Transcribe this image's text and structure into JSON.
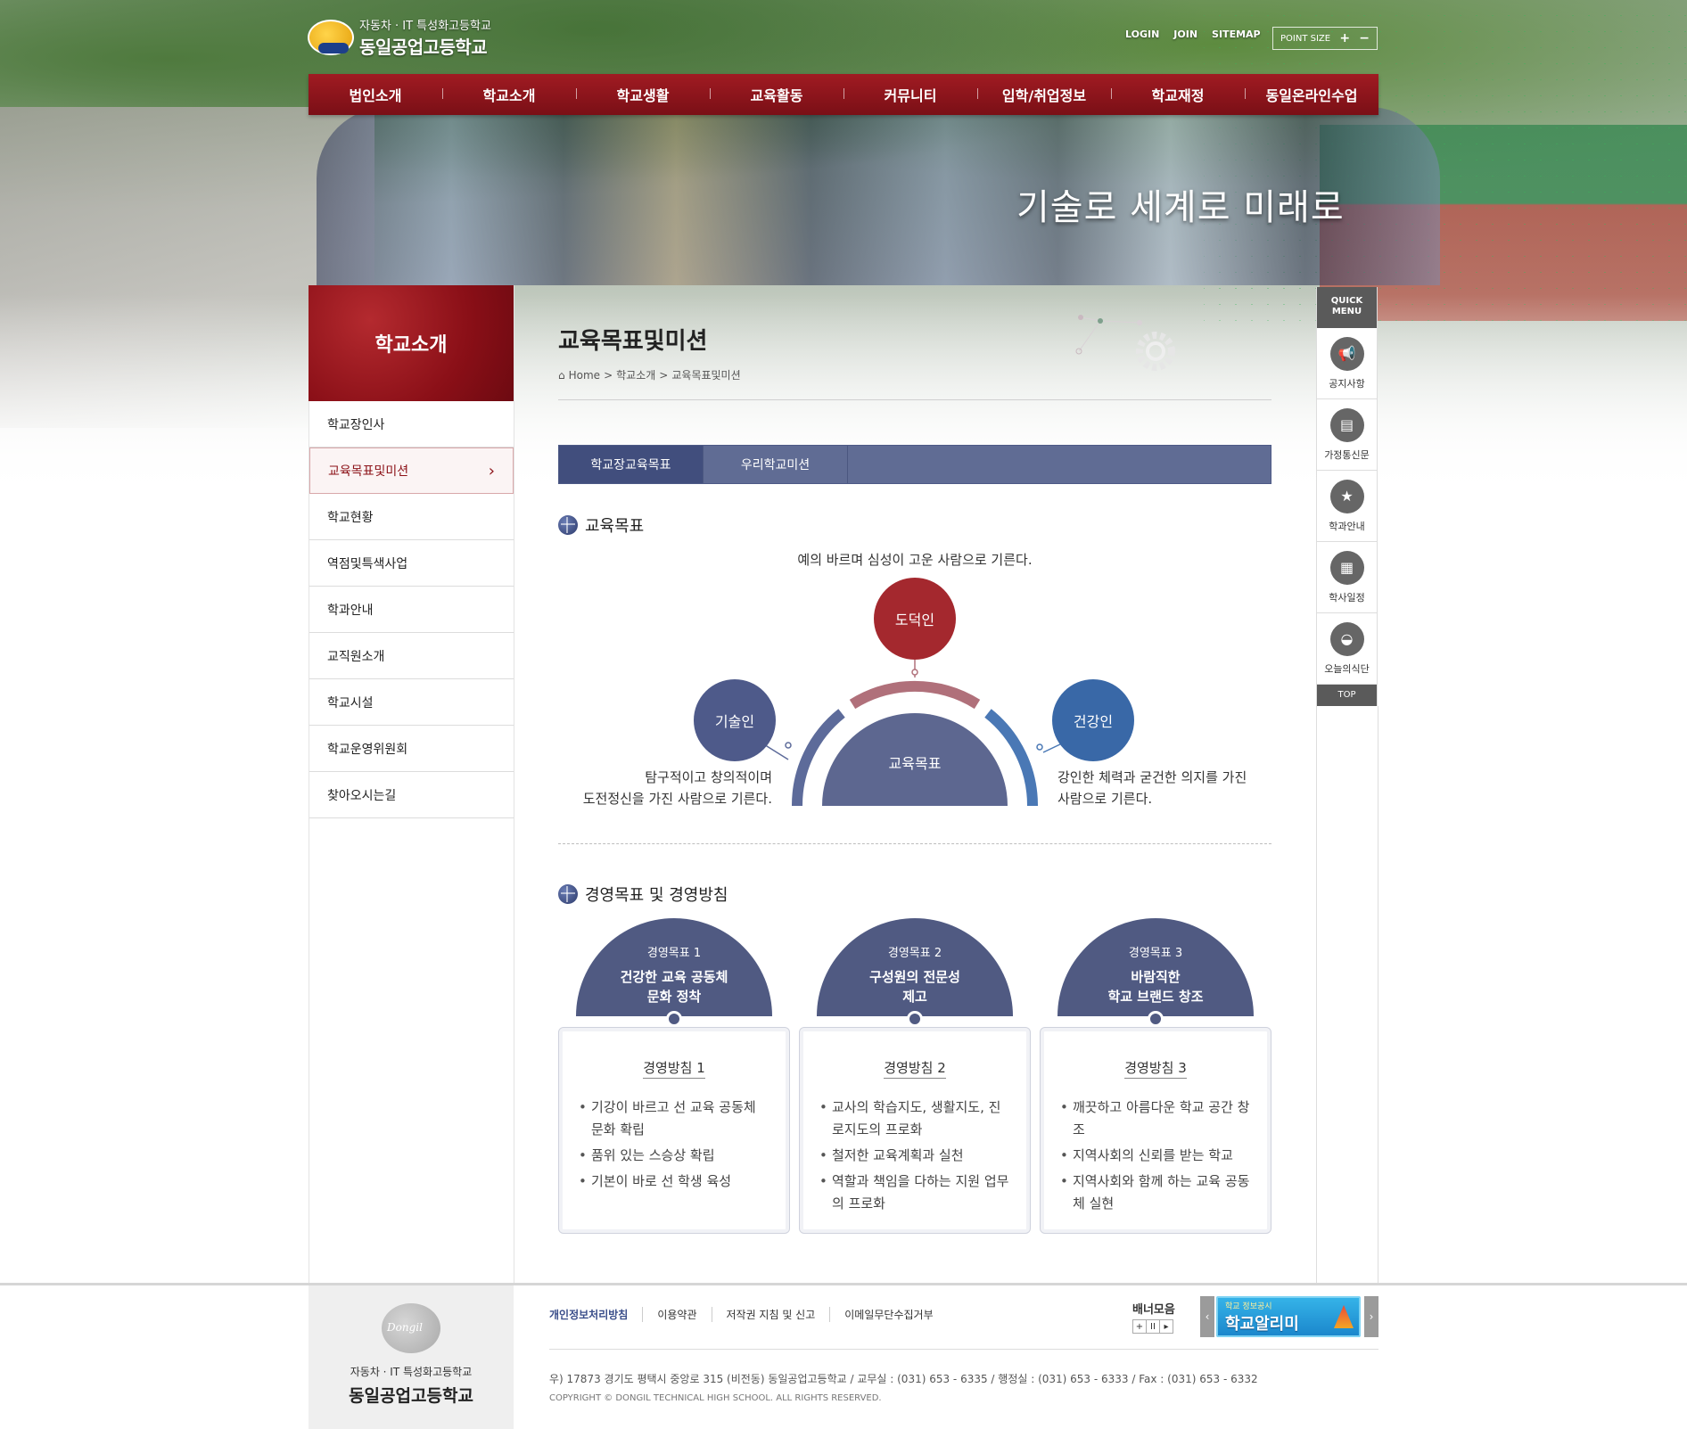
{
  "header": {
    "logo_sub": "자동차 · IT 특성화고등학교",
    "logo_name": "동일공업고등학교",
    "links": [
      "LOGIN",
      "JOIN",
      "SITEMAP"
    ],
    "point_size_label": "POINT SIZE",
    "point_plus": "+",
    "point_minus": "−",
    "slogan": "기술로 세계로 미래로"
  },
  "gnb": [
    "법인소개",
    "학교소개",
    "학교생활",
    "교육활동",
    "커뮤니티",
    "입학/취업정보",
    "학교재정",
    "동일온라인수업"
  ],
  "sidebar": {
    "title": "학교소개",
    "items": [
      "학교장인사",
      "교육목표및미션",
      "학교현황",
      "역점및특색사업",
      "학과안내",
      "교직원소개",
      "학교시설",
      "학교운영위원회",
      "찾아오시는길"
    ],
    "active_index": 1,
    "chevron": "›"
  },
  "page": {
    "title": "교육목표및미션",
    "breadcrumb": [
      "Home",
      "학교소개",
      "교육목표및미션"
    ],
    "breadcrumb_sep": ">",
    "home_icon": "⌂"
  },
  "tabs": [
    "학교장교육목표",
    "우리학교미션"
  ],
  "education": {
    "heading": "교육목표",
    "lead": "예의 바르며 심성이 고운 사람으로 기른다.",
    "center": "교육목표",
    "top": "도덕인",
    "left": "기술인",
    "right": "건강인",
    "left_desc": [
      "탐구적이고 창의적이며",
      "도전정신을 가진 사람으로 기른다."
    ],
    "right_desc": [
      "강인한 체력과 굳건한 의지를 가진",
      "사람으로 기른다."
    ],
    "colors": {
      "top": "#a4282e",
      "left": "#4e5a8a",
      "right": "#3968a7",
      "center": "#5d6790"
    }
  },
  "management": {
    "heading": "경영목표 및 경영방침",
    "goals": [
      {
        "label": "경영목표 1",
        "title": [
          "건강한 교육 공동체",
          "문화 정착"
        ],
        "policy": "경영방침 1",
        "items": [
          "기강이 바르고 선 교육 공동체 문화 확립",
          "품위 있는 스승상 확립",
          "기본이 바로 선 학생 육성"
        ]
      },
      {
        "label": "경영목표 2",
        "title": [
          "구성원의 전문성",
          "제고"
        ],
        "policy": "경영방침 2",
        "items": [
          "교사의 학습지도, 생활지도, 진로지도의 프로화",
          "철저한 교육계획과 실천",
          "역할과 책임을 다하는 지원 업무의 프로화"
        ]
      },
      {
        "label": "경영목표 3",
        "title": [
          "바람직한",
          "학교 브랜드 창조"
        ],
        "policy": "경영방침 3",
        "items": [
          "깨끗하고 아름다운 학교 공간 창조",
          "지역사회의 신뢰를 받는 학교",
          "지역사회와 함께 하는 교육 공동체 실현"
        ]
      }
    ]
  },
  "quick_menu": {
    "title_top": "QUICK",
    "title_bottom": "MENU",
    "items": [
      {
        "label": "공지사항",
        "icon": "megaphone-icon",
        "glyph": "📢"
      },
      {
        "label": "가정통신문",
        "icon": "newsletter-icon",
        "glyph": "▤"
      },
      {
        "label": "학과안내",
        "icon": "star-icon",
        "glyph": "★"
      },
      {
        "label": "학사일정",
        "icon": "calendar-icon",
        "glyph": "▦"
      },
      {
        "label": "오늘의식단",
        "icon": "meal-icon",
        "glyph": "◒"
      }
    ],
    "top": "TOP"
  },
  "footer": {
    "logo_sub": "자동차 · IT 특성화고등학교",
    "logo_name": "동일공업고등학교",
    "links": [
      "개인정보처리방침",
      "이용약관",
      "저작권 지침 및 신고",
      "이메일무단수집거부"
    ],
    "address": "우) 17873 경기도 평택시 중앙로 315 (비전동) 동일공업고등학교 / 교무실 : (031) 653 - 6335 / 행정실 : (031) 653 - 6333 / Fax : (031) 653 - 6332",
    "copyright": "COPYRIGHT © DONGIL TECHNICAL HIGH SCHOOL. ALL RIGHTS RESERVED.",
    "banner_label": "배너모음",
    "banner_controls": [
      "+",
      "II",
      "▸"
    ],
    "banner_sub": "학교 정보공시",
    "banner_title": "학교알리미",
    "prev": "‹",
    "next": "›"
  }
}
